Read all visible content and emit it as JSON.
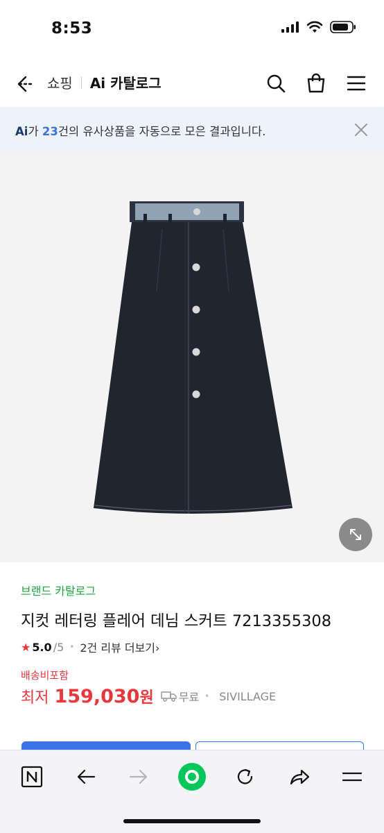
{
  "status_bar": {
    "time": "8:53"
  },
  "nav": {
    "shop_label": "쇼핑",
    "catalog_label": "Ai 카탈로그"
  },
  "ai_banner": {
    "ai_mark": "Ai",
    "prefix": "가 ",
    "count": "23",
    "suffix": "건의 유사상품을 자동으로 모은 결과입니다."
  },
  "product": {
    "brand_catalog_link": "브랜드 카탈로그",
    "title": "지컷 레터링 플레어 데님 스커트 7213355308",
    "rating": {
      "star": "★",
      "score": "5.0",
      "max": "/5",
      "review_link": "2건 리뷰 더보기›"
    },
    "shipping_label": "배송비포함",
    "price": {
      "prefix": "최저",
      "value": "159,030",
      "unit": "원"
    },
    "delivery": "무료",
    "seller": "SIVILLAGE"
  },
  "colors": {
    "accent_blue": "#3b73e4",
    "brand_green": "#1fa33f",
    "price_red": "#e8383d",
    "banner_bg": "#eef3fb",
    "naver_green": "#03c75a"
  },
  "icons": {
    "nav": [
      "back-icon",
      "search-icon",
      "shopping-bag-icon",
      "menu-icon"
    ],
    "toolbar": [
      "naver-n-icon",
      "back-arrow-icon",
      "forward-arrow-icon",
      "green-dot-icon",
      "reload-icon",
      "share-icon",
      "menu-icon"
    ]
  }
}
